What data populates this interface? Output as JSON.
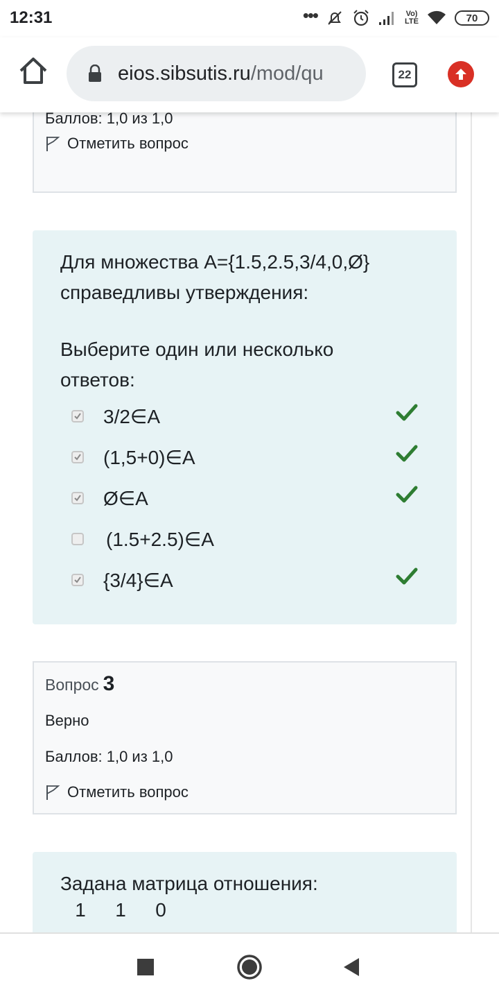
{
  "status_bar": {
    "time": "12:31",
    "volte_top": "Vo)",
    "volte_bottom": "LTE",
    "battery": "70"
  },
  "browser": {
    "url_domain": "eios.sibsutis.ru",
    "url_path": "/mod/qu",
    "tab_count": "22"
  },
  "question1": {
    "score": "Баллов: 1,0 из 1,0",
    "flag_label": "Отметить вопрос"
  },
  "question2": {
    "prompt_line1": "Для множества A={1.5,2.5,3/4,0,Ø}",
    "prompt_line2": "справедливы утверждения:",
    "instruction_line1": "Выберите один или несколько",
    "instruction_line2": "ответов:",
    "answers": [
      {
        "label": "3/2∈A",
        "checked": true,
        "correct_mark": true
      },
      {
        "label": "(1,5+0)∈A",
        "checked": true,
        "correct_mark": true
      },
      {
        "label": "Ø∈A",
        "checked": true,
        "correct_mark": true
      },
      {
        "label": "(1.5+2.5)∈A",
        "checked": false,
        "correct_mark": false
      },
      {
        "label": "{3/4}∈A",
        "checked": true,
        "correct_mark": true
      }
    ]
  },
  "question3": {
    "label": "Вопрос",
    "number": "3",
    "status": "Верно",
    "score": "Баллов: 1,0 из 1,0",
    "flag_label": "Отметить вопрос"
  },
  "question4": {
    "prompt": "Задана матрица отношения:",
    "matrix_row1": [
      "1",
      "1",
      "0"
    ]
  },
  "colors": {
    "correct": "#2e7d32",
    "formulation_bg": "#e7f3f5",
    "info_bg": "#f8f9fa",
    "update_badge": "#d93025"
  }
}
